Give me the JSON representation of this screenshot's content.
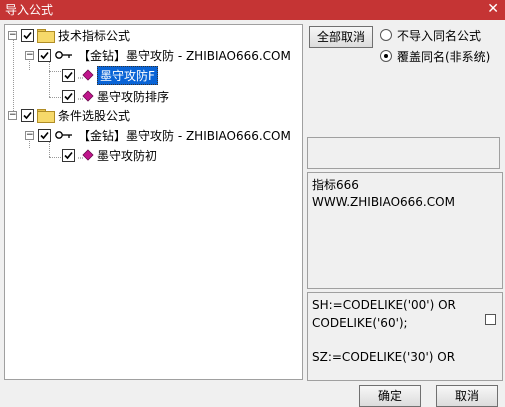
{
  "window": {
    "title": "导入公式",
    "close_glyph": "✕"
  },
  "tree": {
    "root1": {
      "label": "技术指标公式"
    },
    "root1_group": {
      "label": "【金钻】墨守攻防 - ZHIBIAO666.COM"
    },
    "root1_item1": {
      "label": "墨守攻防F"
    },
    "root1_item2": {
      "label": "墨守攻防排序"
    },
    "root2": {
      "label": "条件选股公式"
    },
    "root2_group": {
      "label": "【金钻】墨守攻防 - ZHIBIAO666.COM"
    },
    "root2_item1": {
      "label": "墨守攻防初"
    }
  },
  "options": {
    "deselect_all": "全部取消",
    "no_import_same": "不导入同名公式",
    "overwrite_same": "覆盖同名(非系统)",
    "selected_option": "overwrite_same"
  },
  "description": {
    "line1": "指标666",
    "line2": "WWW.ZHIBIAO666.COM"
  },
  "code": {
    "line1": "SH:=CODELIKE('00') OR",
    "line2": "CODELIKE('60');",
    "line3": "",
    "line4": "SZ:=CODELIKE('30') OR"
  },
  "footer": {
    "ok": "确定",
    "cancel": "取消"
  },
  "colors": {
    "titlebar": "#c53434",
    "selection": "#0a64d6",
    "folder": "#f6d96a",
    "formula_icon": "#c0158c"
  }
}
